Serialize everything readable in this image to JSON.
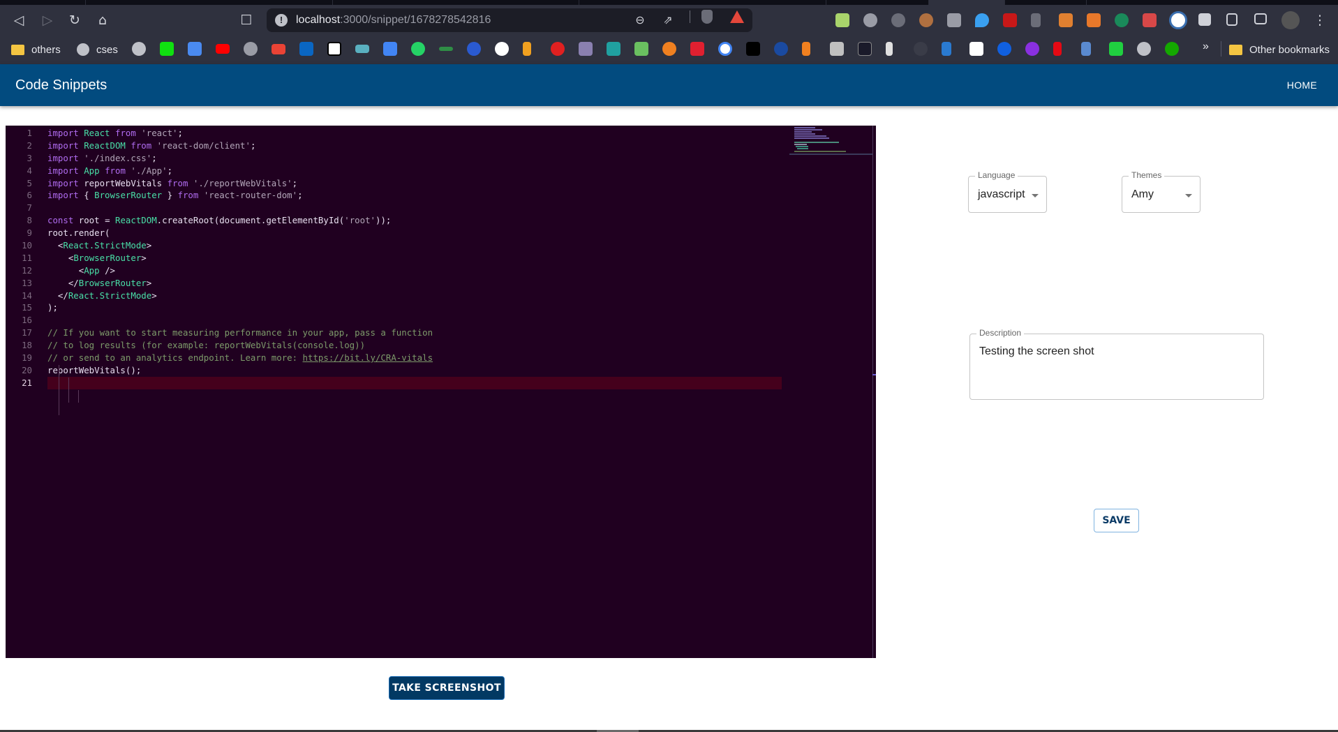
{
  "browser": {
    "url_host": "localhost",
    "url_path": ":3000/snippet/1678278542816",
    "nav": {
      "back": "◁",
      "forward": "▷",
      "reload": "↻",
      "home": "⌂",
      "bookmark": "☐",
      "zoom": "⊖",
      "share": "⇗"
    },
    "bookmarks": [
      {
        "label": "others",
        "icon": "folder-icon"
      },
      {
        "label": "cses",
        "icon": "globe-icon"
      }
    ],
    "bookmarks_more": "»",
    "other_bookmarks": "Other bookmarks"
  },
  "app": {
    "title": "Code Snippets",
    "home_link": "HOME"
  },
  "editor": {
    "lines": [
      [
        [
          "kw",
          "import "
        ],
        [
          "id",
          "React "
        ],
        [
          "kw",
          "from "
        ],
        [
          "str",
          "'react'"
        ],
        [
          "plain",
          ";"
        ]
      ],
      [
        [
          "kw",
          "import "
        ],
        [
          "id",
          "ReactDOM "
        ],
        [
          "kw",
          "from "
        ],
        [
          "str",
          "'react-dom/client'"
        ],
        [
          "plain",
          ";"
        ]
      ],
      [
        [
          "kw",
          "import "
        ],
        [
          "str",
          "'./index.css'"
        ],
        [
          "plain",
          ";"
        ]
      ],
      [
        [
          "kw",
          "import "
        ],
        [
          "id",
          "App "
        ],
        [
          "kw",
          "from "
        ],
        [
          "str",
          "'./App'"
        ],
        [
          "plain",
          ";"
        ]
      ],
      [
        [
          "kw",
          "import "
        ],
        [
          "plain",
          "reportWebVitals "
        ],
        [
          "kw",
          "from "
        ],
        [
          "str",
          "'./reportWebVitals'"
        ],
        [
          "plain",
          ";"
        ]
      ],
      [
        [
          "kw",
          "import "
        ],
        [
          "plain",
          "{ "
        ],
        [
          "id",
          "BrowserRouter "
        ],
        [
          "plain",
          "} "
        ],
        [
          "kw",
          "from "
        ],
        [
          "str",
          "'react-router-dom'"
        ],
        [
          "plain",
          ";"
        ]
      ],
      [],
      [
        [
          "kw",
          "const "
        ],
        [
          "plain",
          "root = "
        ],
        [
          "id",
          "ReactDOM"
        ],
        [
          "plain",
          ".createRoot(document.getElementById("
        ],
        [
          "str",
          "'root'"
        ],
        [
          "plain",
          "));"
        ]
      ],
      [
        [
          "plain",
          "root.render("
        ]
      ],
      [
        [
          "plain",
          "  <"
        ],
        [
          "tag",
          "React.StrictMode"
        ],
        [
          "plain",
          ">"
        ]
      ],
      [
        [
          "plain",
          "    <"
        ],
        [
          "tag",
          "BrowserRouter"
        ],
        [
          "plain",
          ">"
        ]
      ],
      [
        [
          "plain",
          "      <"
        ],
        [
          "tag",
          "App"
        ],
        [
          "plain",
          " />"
        ]
      ],
      [
        [
          "plain",
          "    </"
        ],
        [
          "tag",
          "BrowserRouter"
        ],
        [
          "plain",
          ">"
        ]
      ],
      [
        [
          "plain",
          "  </"
        ],
        [
          "tag",
          "React.StrictMode"
        ],
        [
          "plain",
          ">"
        ]
      ],
      [
        [
          "plain",
          ");"
        ]
      ],
      [],
      [
        [
          "cm",
          "// If you want to start measuring performance in your app, pass a function"
        ]
      ],
      [
        [
          "cm",
          "// to log results (for example: reportWebVitals(console.log))"
        ]
      ],
      [
        [
          "cm",
          "// or send to an analytics endpoint. Learn more: "
        ],
        [
          "lnk",
          "https://bit.ly/CRA-vitals"
        ]
      ],
      [
        [
          "plain",
          "reportWebVitals();"
        ]
      ],
      []
    ],
    "current_line": 21,
    "screenshot_button": "TAKE SCREENSHOT"
  },
  "form": {
    "language": {
      "label": "Language",
      "value": "javascript"
    },
    "theme": {
      "label": "Themes",
      "value": "Amy"
    },
    "description": {
      "label": "Description",
      "value": "Testing the screen shot"
    },
    "save_button": "SAVE"
  },
  "colors": {
    "appbar": "#024b7f",
    "editor_bg": "#200020",
    "screenshot_button": "#023963"
  }
}
